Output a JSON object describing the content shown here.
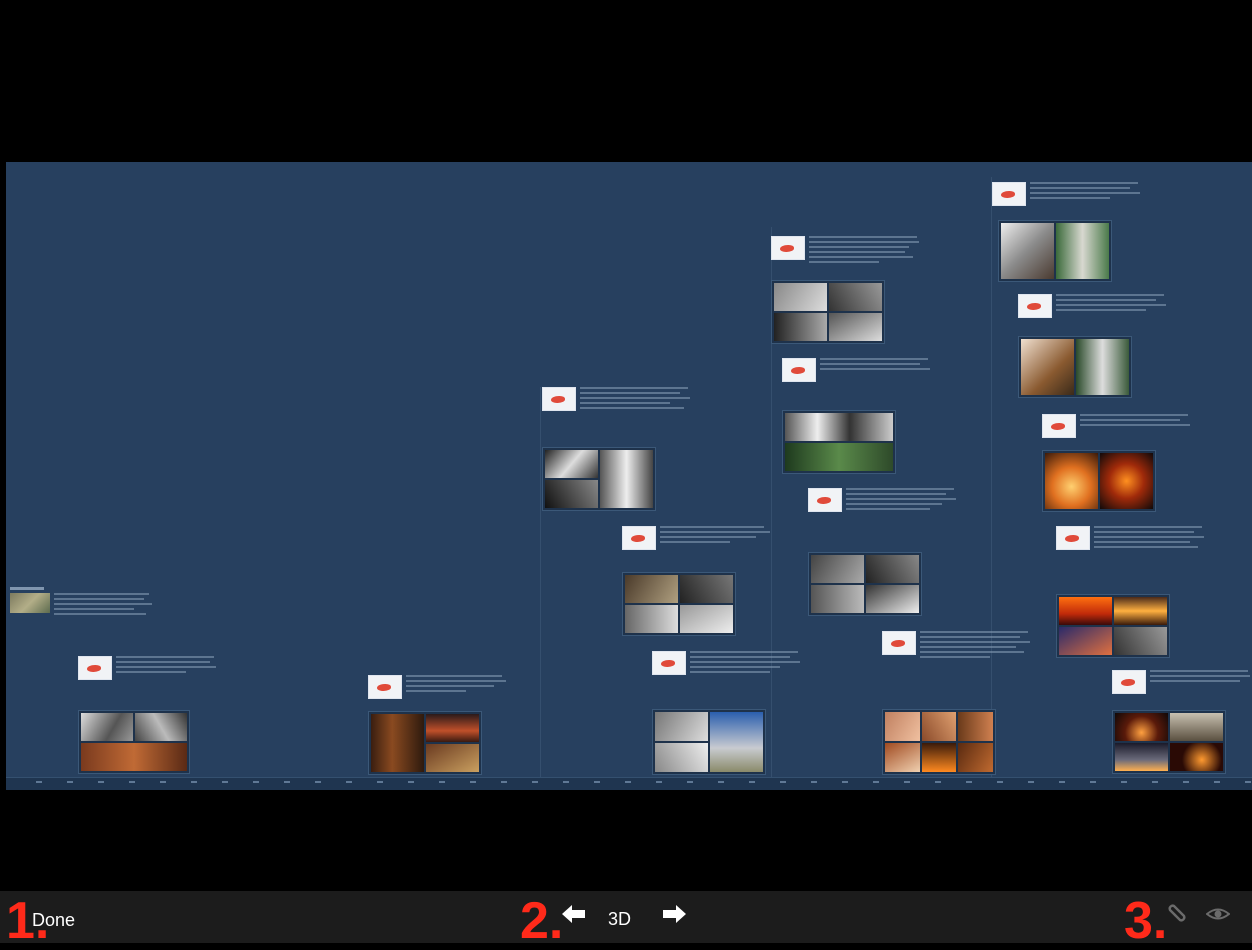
{
  "toolbar": {
    "done_label": "Done",
    "view_mode_label": "3D",
    "marker_1": "1.",
    "marker_2": "2.",
    "marker_3": "3."
  },
  "icons": {
    "back": "arrow-left-icon",
    "forward": "arrow-right-icon",
    "link": "link-icon",
    "visibility": "eye-icon"
  },
  "colors": {
    "canvas": "#27405f",
    "marker": "#ff2a1a",
    "toolbar": "#1c1c1c"
  }
}
